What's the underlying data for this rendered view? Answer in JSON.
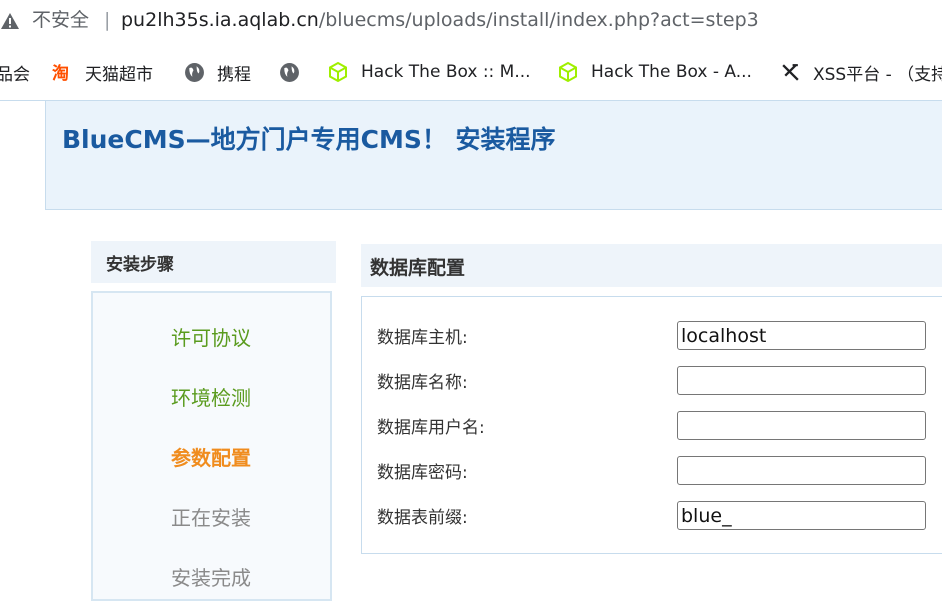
{
  "browser": {
    "security_label": "不安全",
    "separator": "|",
    "url_host": "pu2lh35s.ia.aqlab.cn",
    "url_path": "/bluecms/uploads/install/index.php?act=step3"
  },
  "bookmarks": [
    {
      "label": "品会",
      "icon": "none"
    },
    {
      "label": "天猫超市",
      "icon": "taobao-icon"
    },
    {
      "label": "携程",
      "icon": "globe-icon"
    },
    {
      "label": "",
      "icon": "globe-icon"
    },
    {
      "label": "Hack The Box :: M...",
      "icon": "htb-cube-icon"
    },
    {
      "label": "Hack The Box - A...",
      "icon": "htb-cube-icon"
    },
    {
      "label": "XSS平台 - （支持",
      "icon": "xss-icon"
    }
  ],
  "header": {
    "title": "BlueCMS—地方门户专用CMS！ 安装程序"
  },
  "steps": {
    "heading": "安装步骤",
    "items": [
      {
        "label": "许可协议",
        "state": "done"
      },
      {
        "label": "环境检测",
        "state": "done"
      },
      {
        "label": "参数配置",
        "state": "current"
      },
      {
        "label": "正在安装",
        "state": "todo"
      },
      {
        "label": "安装完成",
        "state": "todo"
      }
    ]
  },
  "config": {
    "heading": "数据库配置",
    "fields": [
      {
        "label": "数据库主机:",
        "value": "localhost"
      },
      {
        "label": "数据库名称:",
        "value": ""
      },
      {
        "label": "数据库用户名:",
        "value": ""
      },
      {
        "label": "数据库密码:",
        "value": ""
      },
      {
        "label": "数据表前缀:",
        "value": "blue_"
      }
    ]
  },
  "colors": {
    "title_blue": "#1a5aa0",
    "step_done": "#5a9b1e",
    "step_current": "#f08c1e",
    "step_todo": "#8a8a8a"
  }
}
